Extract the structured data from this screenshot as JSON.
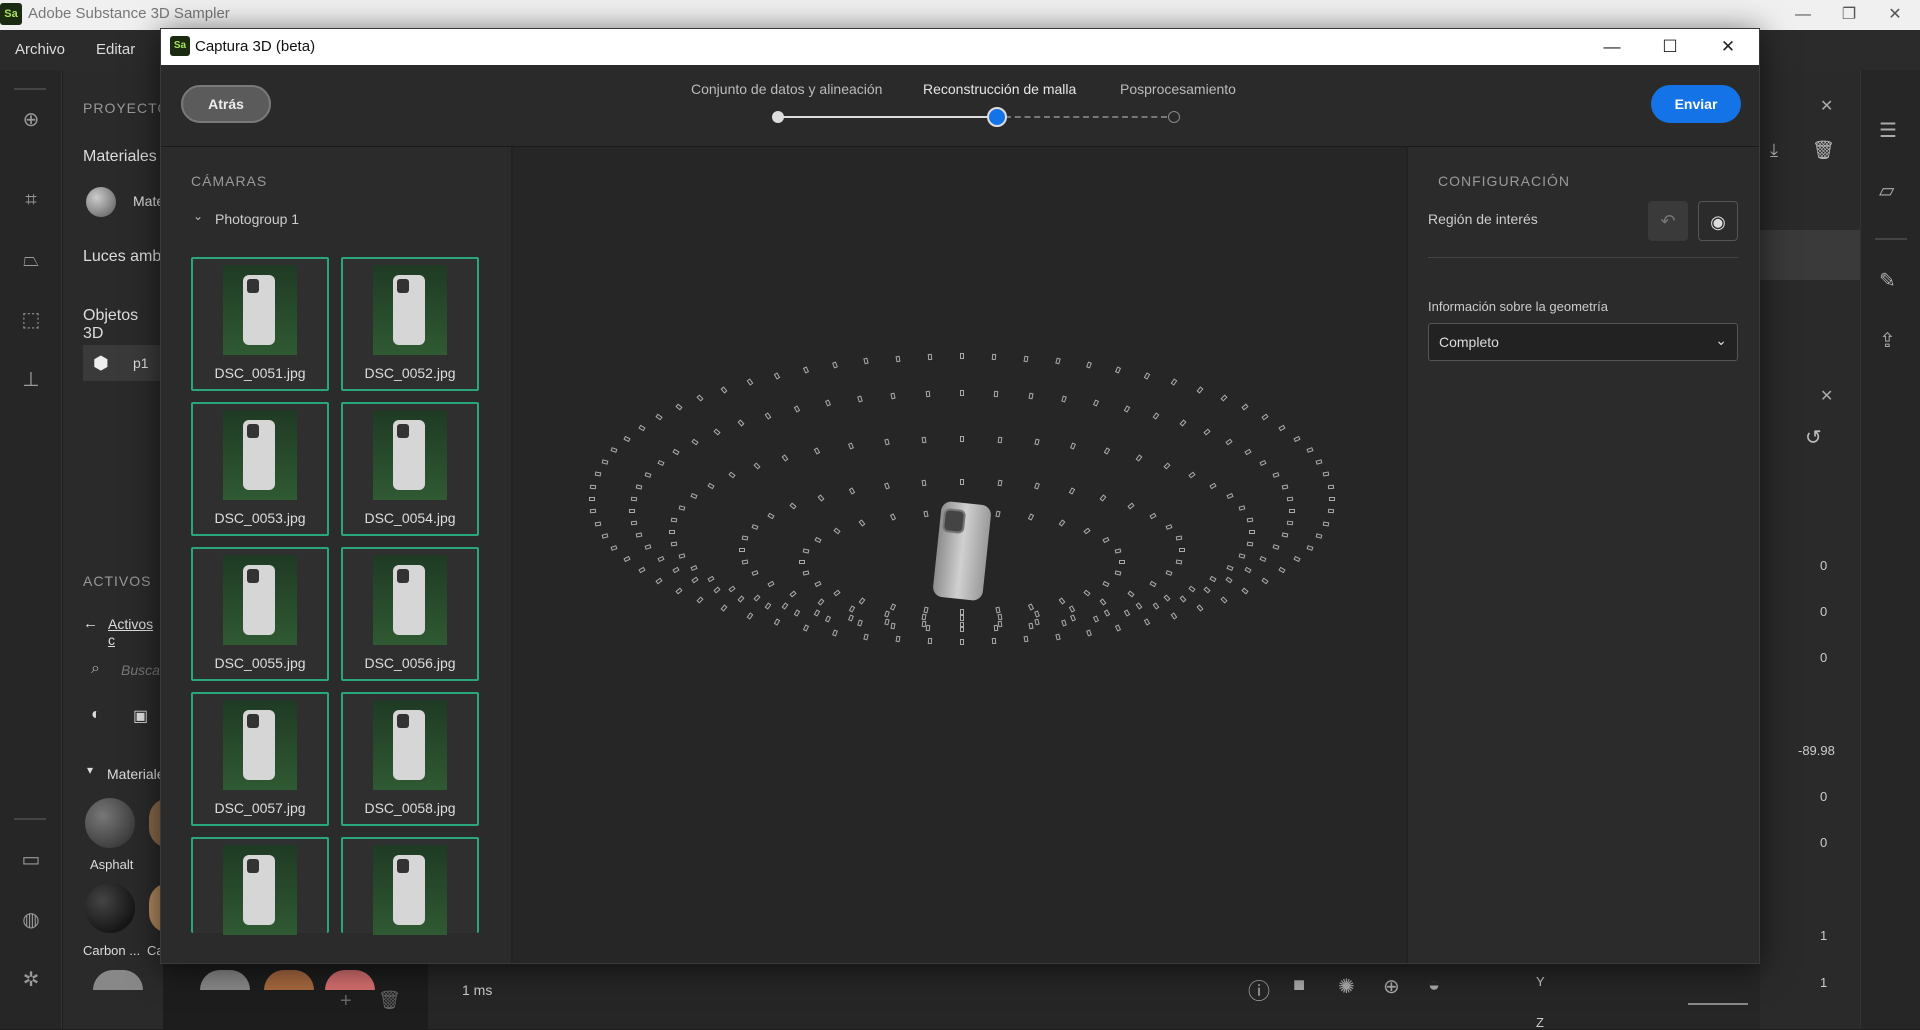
{
  "app": {
    "title": "Adobe Substance 3D Sampler",
    "logo_text": "Sa",
    "menu": [
      "Archivo",
      "Editar"
    ]
  },
  "left_panel": {
    "project_label": "PROYECTO",
    "materials": "Materiales",
    "material_item": "Mate",
    "env_lights": "Luces amb",
    "objects3d": "Objetos 3D",
    "object_item": "p1",
    "assets_label": "ACTIVOS",
    "assets_link": "Activos c",
    "search_placeholder": "Buscar",
    "materials_section": "Materiale",
    "swatches": [
      "Asphalt",
      "Carbon ...",
      "Ca"
    ]
  },
  "right_panel": {
    "values": [
      "0",
      "0",
      "0",
      "-89.98",
      "0",
      "0",
      "1",
      "1"
    ],
    "y_label": "Y",
    "z_label": "Z"
  },
  "bottom": {
    "timing": "1 ms"
  },
  "dialog": {
    "title": "Captura 3D (beta)",
    "back": "Atrás",
    "send": "Enviar",
    "steps": [
      {
        "label": "Conjunto de datos y alineación",
        "state": "done"
      },
      {
        "label": "Reconstrucción de malla",
        "state": "active"
      },
      {
        "label": "Posprocesamiento",
        "state": "pending"
      }
    ],
    "cameras": {
      "header": "CÁMARAS",
      "group": "Photogroup 1",
      "images": [
        "DSC_0051.jpg",
        "DSC_0052.jpg",
        "DSC_0053.jpg",
        "DSC_0054.jpg",
        "DSC_0055.jpg",
        "DSC_0056.jpg",
        "DSC_0057.jpg",
        "DSC_0058.jpg",
        "",
        ""
      ]
    },
    "config": {
      "header": "CONFIGURACIÓN",
      "roi_label": "Región de interés",
      "geometry_label": "Información sobre la geometría",
      "geometry_value": "Completo"
    }
  },
  "colors": {
    "accent": "#1473e6",
    "selection": "#2aa77a",
    "logo_green": "#a7e35e"
  }
}
